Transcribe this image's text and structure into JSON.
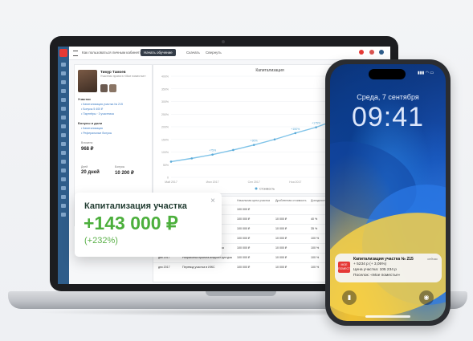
{
  "topbar": {
    "hint": "Как пользоваться личным кабинетом",
    "cta": "Начать обучение",
    "link1": "Скачать",
    "link2": "Свернуть"
  },
  "profile": {
    "name": "Тимур Тамоев",
    "subtitle": "Участник проекта «Мое поместье»",
    "section_participants": "Участки",
    "links": [
      "• Капитализация участка № 215",
      "• Бонусы 5 400 ₽",
      "• Партнёры · 3 участника"
    ],
    "section_bonuses": "Бонусы и доли",
    "links2": [
      "• Капитализация",
      "• Реферальные бонусы"
    ],
    "invested_label": "Вложено",
    "invested": "968 ₽",
    "bonus_label": "Бонусы",
    "bonus": "10 200 ₽",
    "days_label": "Дней",
    "days": "20 дней"
  },
  "chart": {
    "title": "Капитализация",
    "legend": "Стоимость"
  },
  "chart_data": {
    "type": "line",
    "title": "Капитализация",
    "categories": [
      "Май 2017",
      "Июн 2017",
      "Июл 2017",
      "Авг 2017",
      "Сен 2017",
      "Окт 2017",
      "Ноя 2017",
      "Дек 2017",
      "Янв 2018",
      "Фев 2018",
      "Мар 2018"
    ],
    "values": [
      62,
      75,
      90,
      108,
      128,
      150,
      175,
      198,
      228,
      262,
      300
    ],
    "point_labels": [
      "",
      "",
      "+75%",
      "",
      "+90%",
      "",
      "+150%",
      "+175%",
      "",
      "",
      "+198%"
    ],
    "ylim": [
      0,
      400
    ],
    "yticks": [
      "0",
      "50%",
      "100%",
      "150%",
      "200%",
      "250%",
      "300%",
      "350%",
      "400%"
    ]
  },
  "table": {
    "headers": [
      "Дата",
      "Операция",
      "Начальная цена участка",
      "Дробленная стоимость",
      "Доходность"
    ],
    "rows": [
      [
        "",
        "",
        "100 000 ₽",
        "",
        ""
      ],
      [
        "",
        "",
        "100 000 ₽",
        "10 000 ₽",
        "40 %"
      ],
      [
        "",
        "",
        "100 000 ₽",
        "10 000 ₽",
        "35 %"
      ],
      [
        "",
        "",
        "100 000 ₽",
        "10 000 ₽",
        "100 %"
      ],
      [
        "дек 2017",
        "Увеличение стоимости участка",
        "100 000 ₽",
        "10 000 ₽",
        "100 %"
      ],
      [
        "дек 2017",
        "Разработка проекта инфраструктуры",
        "100 000 ₽",
        "10 000 ₽",
        "100 %"
      ],
      [
        "дек 2017",
        "Перевод участка в ИЖС",
        "100 000 ₽",
        "10 000 ₽",
        "100 %"
      ]
    ]
  },
  "card": {
    "title": "Капитализация участка",
    "value": "+143 000 ₽",
    "percent": "(+232%)",
    "close": "×"
  },
  "phone": {
    "date": "Среда, 7 сентября",
    "time": "09:41",
    "notif_title": "Капитализация участка № 215",
    "notif_time": "сейчас",
    "notif_line1": "+ 5234 р (+ 3,05%)",
    "notif_line2": "Цена участка: 105 234 р",
    "notif_line3": "Поселок: «Мое поместье»",
    "notif_logo": "МОЕ ПОМЕСТЬЕ"
  },
  "colors": {
    "accent_green": "#4caf3c",
    "brand_red": "#e53935",
    "sidebar_blue": "#2f5d8a"
  }
}
